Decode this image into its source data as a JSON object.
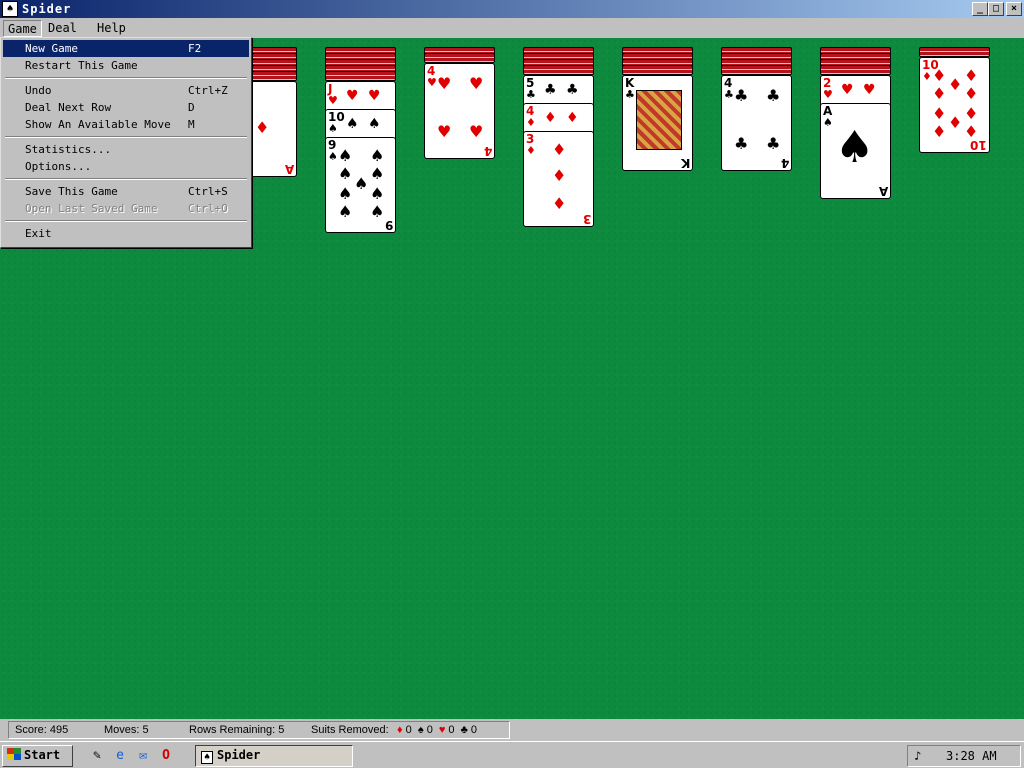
{
  "window": {
    "title": "Spider",
    "app_icon": "spider-app-icon"
  },
  "caption_buttons": {
    "minimize": "_",
    "maximize": "□",
    "close": "×"
  },
  "menubar": {
    "items": [
      "Game",
      "Deal",
      "Help"
    ]
  },
  "game_menu": {
    "items": [
      {
        "label": "New Game",
        "shortcut": "F2",
        "highlighted": true
      },
      {
        "label": "Restart This Game",
        "shortcut": ""
      },
      {
        "separator": true
      },
      {
        "label": "Undo",
        "shortcut": "Ctrl+Z"
      },
      {
        "label": "Deal Next Row",
        "shortcut": "D"
      },
      {
        "label": "Show An Available Move",
        "shortcut": "M"
      },
      {
        "separator": true
      },
      {
        "label": "Statistics...",
        "shortcut": ""
      },
      {
        "label": "Options...",
        "shortcut": ""
      },
      {
        "separator": true
      },
      {
        "label": "Save This Game",
        "shortcut": "Ctrl+S"
      },
      {
        "label": "Open Last Saved Game",
        "shortcut": "Ctrl+O",
        "disabled": true
      },
      {
        "separator": true
      },
      {
        "label": "Exit",
        "shortcut": ""
      }
    ]
  },
  "tableau": {
    "columns": [
      {
        "hidden": 5,
        "cards": [
          {
            "rank": "A",
            "suit": "♦"
          }
        ]
      },
      {
        "hidden": 5,
        "cards": [
          {
            "rank": "J",
            "suit": "♥"
          },
          {
            "rank": "10",
            "suit": "♠"
          },
          {
            "rank": "9",
            "suit": "♠"
          }
        ]
      },
      {
        "hidden": 2,
        "cards": [
          {
            "rank": "4",
            "suit": "♥"
          }
        ]
      },
      {
        "hidden": 4,
        "cards": [
          {
            "rank": "5",
            "suit": "♣"
          },
          {
            "rank": "4",
            "suit": "♦"
          },
          {
            "rank": "3",
            "suit": "♦"
          }
        ]
      },
      {
        "hidden": 4,
        "cards": [
          {
            "rank": "K",
            "suit": "♣"
          }
        ]
      },
      {
        "hidden": 4,
        "cards": [
          {
            "rank": "4",
            "suit": "♣"
          }
        ]
      },
      {
        "hidden": 4,
        "cards": [
          {
            "rank": "2",
            "suit": "♥"
          },
          {
            "rank": "A",
            "suit": "♠"
          }
        ]
      },
      {
        "hidden": 1,
        "cards": [
          {
            "rank": "10",
            "suit": "♦"
          }
        ]
      }
    ]
  },
  "status": {
    "score": "Score: 495",
    "moves": "Moves: 5",
    "rows_remaining": "Rows Remaining: 5",
    "suits_label": "Suits Removed:",
    "suits": [
      {
        "suit": "♦",
        "count": "0",
        "color": "#e00000"
      },
      {
        "suit": "♠",
        "count": "0",
        "color": "#000000"
      },
      {
        "suit": "♥",
        "count": "0",
        "color": "#e00000"
      },
      {
        "suit": "♣",
        "count": "0",
        "color": "#000000"
      }
    ]
  },
  "taskbar": {
    "start_label": "Start",
    "quick_launch": [
      "desktop-icon",
      "ie-icon",
      "outlook-icon",
      "opera-icon"
    ],
    "task_label": "Spider",
    "clock": "3:28 AM"
  },
  "colors": {
    "felt": "#0d8a3e",
    "titlebar": "#0a246a",
    "highlight": "#0a246a"
  }
}
